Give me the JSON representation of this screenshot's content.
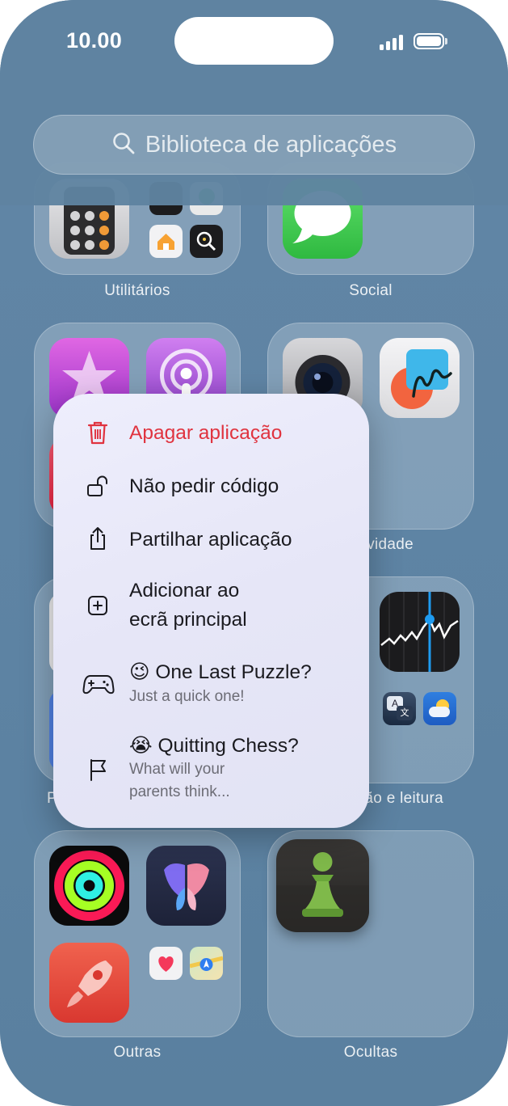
{
  "status_bar": {
    "time": "10.00"
  },
  "search": {
    "placeholder": "Biblioteca de aplicações",
    "icon": "magnifier-icon"
  },
  "folders": {
    "utilities": {
      "label": "Utilitários"
    },
    "social": {
      "label": "Social"
    },
    "productivity": {
      "label_visible_part": "vidade"
    },
    "info_reading": {
      "label_visible_part": "ão e leitura"
    },
    "left_middle": {
      "label_visible_part": "P"
    },
    "other": {
      "label": "Outras"
    },
    "hidden": {
      "label": "Ocultas"
    }
  },
  "context_menu": {
    "items": [
      {
        "label": "Apagar aplicação",
        "icon": "trash-icon",
        "color": "#e0333f"
      },
      {
        "label": "Não pedir código",
        "icon": "unlock-icon"
      },
      {
        "label": "Partilhar aplicação",
        "icon": "share-icon"
      },
      {
        "label_line1": "Adicionar ao",
        "label_line2": "ecrã principal",
        "icon": "plus-square-icon"
      },
      {
        "emoji": "😉",
        "label": "One Last Puzzle?",
        "subtitle": "Just a quick one!",
        "icon": "gamepad-icon"
      },
      {
        "emoji": "😭",
        "label": "Quitting Chess?",
        "subtitle_line1": "What will your",
        "subtitle_line2": "parents think...",
        "icon": "flag-icon"
      }
    ]
  },
  "colors": {
    "background": "#5f86a6",
    "destructive": "#e0333f"
  }
}
